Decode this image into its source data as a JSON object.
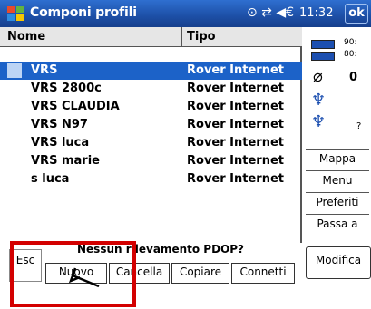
{
  "title_bar": {
    "app_title": "Componi profili",
    "clock": "11:32",
    "ok_label": "ok",
    "status_icons": "⊙ ⇄ ◀€"
  },
  "list": {
    "headers": {
      "name": "Nome",
      "type": "Tipo"
    },
    "rows": [
      {
        "name": "VRS",
        "type": "Rover Internet",
        "selected": true
      },
      {
        "name": "VRS 2800c",
        "type": "Rover Internet"
      },
      {
        "name": "VRS CLAUDIA",
        "type": "Rover Internet"
      },
      {
        "name": "VRS N97",
        "type": "Rover Internet"
      },
      {
        "name": "VRS luca",
        "type": "Rover Internet"
      },
      {
        "name": "VRS marie",
        "type": "Rover Internet"
      },
      {
        "name": "s luca",
        "type": "Rover Internet"
      }
    ]
  },
  "side": {
    "battery1": "90:",
    "battery2": "80:",
    "satellites": "0",
    "question_mark": "?",
    "buttons": [
      "Mappa",
      "Menu",
      "Preferiti",
      "Passa a"
    ],
    "modifica": "Modifica"
  },
  "bottom": {
    "status": "Nessun rilevamento PDOP?",
    "esc": "Esc",
    "tabs": [
      "Nuovo",
      "Cancella",
      "Copiare",
      "Connetti"
    ]
  },
  "colors": {
    "accent": "#1c62c8",
    "highlight_box": "#d30000"
  }
}
